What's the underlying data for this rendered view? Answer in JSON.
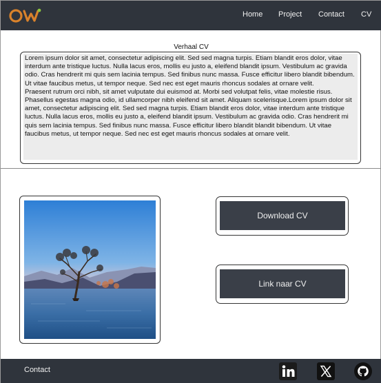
{
  "header": {
    "logo_text": "OW",
    "nav": [
      "Home",
      "Project",
      "Contact",
      "CV"
    ]
  },
  "cv": {
    "title": "Verhaal CV",
    "paragraph1": "Lorem ipsum dolor sit amet, consectetur adipiscing elit. Sed sed magna turpis. Etiam blandit eros dolor, vitae interdum ante tristique luctus. Nulla lacus eros, mollis eu justo a, eleifend blandit ipsum. Vestibulum ac gravida odio. Cras hendrerit mi quis sem lacinia tempus. Sed finibus nunc massa. Fusce efficitur libero blandit bibendum. Ut vitae faucibus metus, ut tempor neque. Sed nec est eget mauris rhoncus sodales at ornare velit.",
    "paragraph2": "Praesent rutrum orci nibh, sit amet vulputate dui euismod at. Morbi sed volutpat felis, vitae molestie risus. Phasellus egestas magna odio, id ullamcorper nibh eleifend sit amet. Aliquam scelerisque.Lorem ipsum dolor sit amet, consectetur adipiscing elit. Sed sed magna turpis. Etiam blandit eros dolor, vitae interdum ante tristique luctus. Nulla lacus eros, mollis eu justo a, eleifend blandit ipsum. Vestibulum ac gravida odio. Cras hendrerit mi quis sem lacinia tempus. Sed finibus nunc massa. Fusce efficitur libero blandit blandit bibendum. Ut vitae faucibus metus, ut tempor neque. Sed nec est eget mauris rhoncus sodales at ornare velit."
  },
  "actions": {
    "download_label": "Download CV",
    "link_label": "Link naar CV"
  },
  "footer": {
    "contact_label": "Contact",
    "icons": [
      "linkedin-icon",
      "x-icon",
      "github-icon"
    ]
  },
  "colors": {
    "navbar": "#2f343c",
    "button": "#3a3f48",
    "logo_orange": "#d9822b",
    "logo_green": "#8dc63f",
    "text_box_bg": "#ececec"
  }
}
